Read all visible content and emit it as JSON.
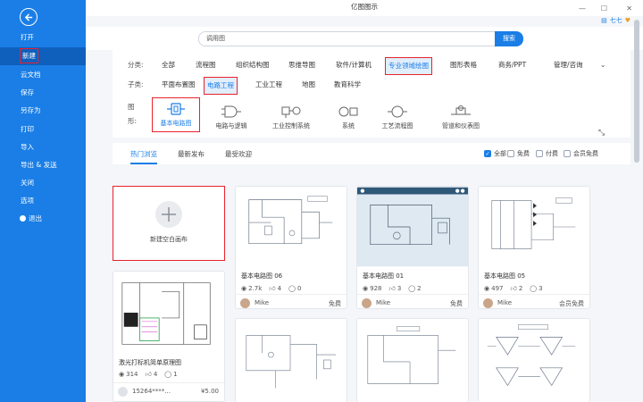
{
  "app": {
    "title": "亿图图示",
    "user": "七七"
  },
  "sidebar": {
    "items": [
      {
        "label": "打开"
      },
      {
        "label": "新建"
      },
      {
        "label": "云文档"
      },
      {
        "label": "保存"
      },
      {
        "label": "另存为"
      },
      {
        "label": "打印"
      },
      {
        "label": "导入"
      },
      {
        "label": "导出 & 发送"
      },
      {
        "label": "关闭"
      },
      {
        "label": "选项"
      },
      {
        "label": "退出"
      }
    ]
  },
  "search": {
    "value": "调用图",
    "button": "搜索"
  },
  "filters": {
    "category_key": "分类:",
    "categories": [
      "全部",
      "流程图",
      "组织结构图",
      "思维导图",
      "软件/计算机",
      "专业领域绘图",
      "图形表格",
      "商务/PPT",
      "管理/咨询"
    ],
    "sub_key": "子类:",
    "subcategories": [
      "平面布置图",
      "电路工程",
      "工业工程",
      "地图",
      "教育科学"
    ],
    "shape_key": "图形:",
    "shapes": [
      "基本电路图",
      "电路与逻辑",
      "工业控制系统",
      "系统",
      "工艺流程图",
      "管道和仪表图"
    ]
  },
  "tabs": [
    "热门浏览",
    "最新发布",
    "最受欢迎"
  ],
  "price_filters": [
    {
      "label": "全部",
      "checked": true
    },
    {
      "label": "免费",
      "checked": false
    },
    {
      "label": "付费",
      "checked": false
    },
    {
      "label": "会员免费",
      "checked": false
    }
  ],
  "new_blank": {
    "label": "新建空白画布"
  },
  "cards": [
    {
      "title": "基本电路图 06",
      "views": "2.7k",
      "likes": "4",
      "comments": "0",
      "author": "Mike",
      "price": "免费"
    },
    {
      "title": "基本电路图 01",
      "views": "928",
      "likes": "3",
      "comments": "2",
      "author": "Mike",
      "price": "免费"
    },
    {
      "title": "基本电路图 05",
      "views": "497",
      "likes": "2",
      "comments": "3",
      "author": "Mike",
      "price": "会员免费"
    },
    {
      "title": "激光打标机简单原理图",
      "views": "314",
      "likes": "4",
      "comments": "1",
      "author": "15264****...",
      "price": "¥5.00"
    }
  ],
  "colors": {
    "accent": "#1a7ee6",
    "sidebar": "#1a7ee6",
    "highlight": "#e8222d"
  }
}
